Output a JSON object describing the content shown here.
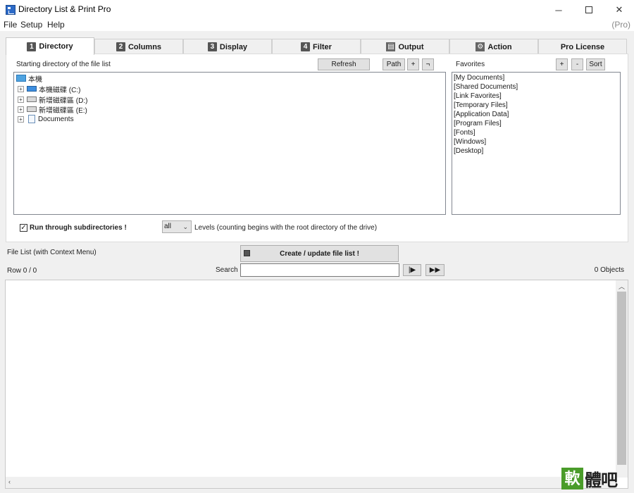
{
  "window": {
    "title": "Directory List & Print Pro",
    "edition": "(Pro)"
  },
  "menu": [
    "File",
    "Setup",
    "Help"
  ],
  "tabs": [
    {
      "num": "1",
      "label": "Directory",
      "active": true
    },
    {
      "num": "2",
      "label": "Columns"
    },
    {
      "num": "3",
      "label": "Display"
    },
    {
      "num": "4",
      "label": "Filter"
    },
    {
      "num": "",
      "label": "Output",
      "icon": "document-icon"
    },
    {
      "num": "",
      "label": "Action",
      "icon": "gear-icon"
    },
    {
      "num": "",
      "label": "Pro License"
    }
  ],
  "directory": {
    "start_label": "Starting directory of the file list",
    "refresh": "Refresh",
    "path": "Path",
    "plus": "+",
    "minus": "¬",
    "tree": [
      {
        "label": "本機",
        "icon": "computer-icon",
        "indent": 0
      },
      {
        "label": "本機磁碟 (C:)",
        "icon": "drive-icon",
        "indent": 1
      },
      {
        "label": "新增磁碟區 (D:)",
        "icon": "drive-icon",
        "indent": 1
      },
      {
        "label": "新增磁碟區 (E:)",
        "icon": "drive-icon",
        "indent": 1
      },
      {
        "label": "Documents",
        "icon": "document-icon",
        "indent": 1
      }
    ]
  },
  "favorites": {
    "label": "Favorites",
    "add": "+",
    "remove": "-",
    "sort": "Sort",
    "items": [
      "[My Documents]",
      "[Shared Documents]",
      "[Link Favorites]",
      "[Temporary Files]",
      "[Application Data]",
      "[Program Files]",
      "[Fonts]",
      "[Windows]",
      "[Desktop]"
    ]
  },
  "options": {
    "subdirs_label": "Run through subdirectories !",
    "subdirs_checked": true,
    "levels_value": "all",
    "levels_label": "Levels  (counting begins with the root directory of the drive)"
  },
  "filelist": {
    "title": "File List (with Context Menu)",
    "create_button": "Create / update file list !",
    "row_info": "Row 0 / 0",
    "search_label": "Search",
    "search_value": "",
    "next_btn": "|▶",
    "all_btn": "▶▶",
    "objects": "0 Objects"
  },
  "watermark": {
    "box": "軟",
    "text": "體吧"
  }
}
